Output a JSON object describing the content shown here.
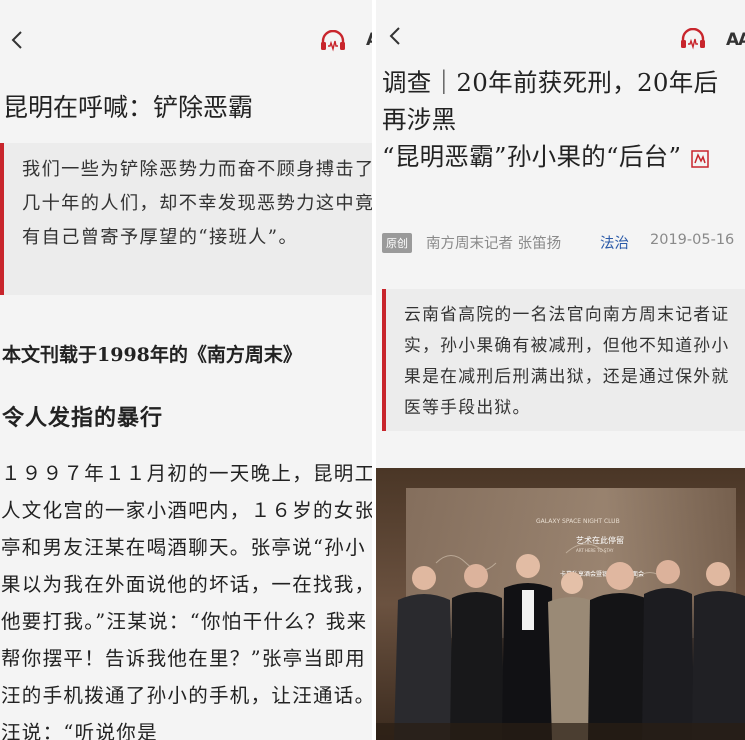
{
  "left": {
    "nav": {
      "back_icon": "chevron-left-icon",
      "audio_icon": "headphones-icon",
      "font_size_label": "AA"
    },
    "title": "昆明在呼喊：铲除恶霸",
    "quote": "我们一些为铲除恶势力而奋不顾身搏击了几十年的人们，却不幸发现恶势力这中竟有自己曾寄予厚望的“接班人”。",
    "source_note": "本文刊载于1998年的《南方周末》",
    "subheading": "令人发指的暴行",
    "body": "１９９７年１１月初的一天晚上，昆明工人文化宫的一家小酒吧内，１６岁的女张亭和男友汪某在喝酒聊天。张亭说“孙小果以为我在外面说他的坏话，一在找我，他要打我。”汪某说：“你怕干什么？我来帮你摆平！告诉我他在里？”张亭当即用汪的手机拨通了孙小的手机，让汪通话。汪说：“听说你是"
  },
  "right": {
    "nav": {
      "back_icon": "chevron-left-icon",
      "audio_icon": "headphones-icon",
      "font_size_label": "AA"
    },
    "title_line1": "调查｜20年前获死刑，20年后再涉黑",
    "title_line2": "“昆明恶霸”孙小果的“后台”",
    "meta": {
      "badge": "原创",
      "author": "南方周末记者 张笛扬",
      "category": "法治",
      "date": "2019-05-16"
    },
    "quote": "云南省高院的一名法官向南方周末记者证实，孙小果确有被减刑，但他不知道孙小果是在减刑后刑满出狱，还是通过保外就医等手段出狱。",
    "photo": {
      "banner_line1": "GALAXY SPACE NIGHT CLUB",
      "banner_line2": "艺术在此停留",
      "banner_line3": "ART HERE TO STAY",
      "banner_line4": "卡慕私享酒会暨银河空间见面会"
    }
  },
  "colors": {
    "accent_red": "#c8252c",
    "link_blue": "#2b5aa8",
    "bg": "#f4f4f4"
  }
}
